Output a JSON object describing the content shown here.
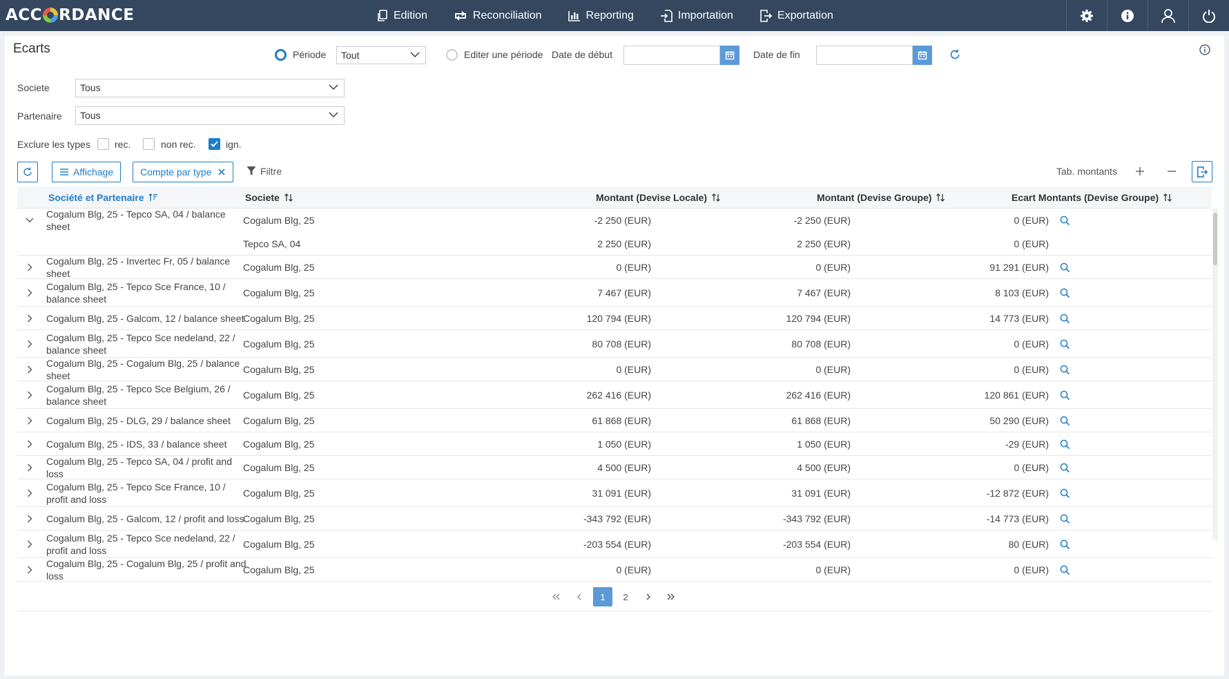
{
  "app": {
    "logo_left": "ACC",
    "logo_right": "RDANCE"
  },
  "nav": [
    {
      "label": "Edition",
      "icon": "copy-icon"
    },
    {
      "label": "Reconciliation",
      "icon": "swap-icon"
    },
    {
      "label": "Reporting",
      "icon": "bar-chart-icon"
    },
    {
      "label": "Importation",
      "icon": "import-icon"
    },
    {
      "label": "Exportation",
      "icon": "export-icon"
    }
  ],
  "page": {
    "title": "Ecarts"
  },
  "filters": {
    "periode_label": "Période",
    "periode_value": "Tout",
    "edit_periode_label": "Editer une période",
    "date_debut_label": "Date de début",
    "date_debut_value": "",
    "date_fin_label": "Date de fin",
    "date_fin_value": "",
    "societe_label": "Societe",
    "societe_value": "Tous",
    "partenaire_label": "Partenaire",
    "partenaire_value": "Tous",
    "exclude_label": "Exclure les types",
    "types": [
      {
        "label": "rec.",
        "checked": false
      },
      {
        "label": "non rec.",
        "checked": false
      },
      {
        "label": "ign.",
        "checked": true
      }
    ]
  },
  "toolbar": {
    "affichage_label": "Affichage",
    "compte_label": "Compte par type",
    "filtre_label": "Filtre",
    "tab_montants_label": "Tab. montants"
  },
  "table": {
    "columns": {
      "name": "Société et Partenaire",
      "societe": "Societe",
      "montant_locale": "Montant",
      "montant_locale_sub": "(Devise Locale)",
      "montant_groupe": "Montant",
      "montant_groupe_sub": "(Devise Groupe)",
      "ecart": "Ecart Montants",
      "ecart_sub": "(Devise Groupe)"
    },
    "rows": [
      {
        "name": "Cogalum Blg, 25 - Tepco SA, 04 / balance sheet",
        "societe": "Cogalum Blg, 25",
        "ml": "-2 250 (EUR)",
        "mg": "-2 250 (EUR)",
        "ec": "0 (EUR)"
      },
      {
        "name": "",
        "societe": "Tepco SA, 04",
        "ml": "2 250 (EUR)",
        "mg": "2 250 (EUR)",
        "ec": "0 (EUR)"
      },
      {
        "name": "Cogalum Blg, 25 - Invertec Fr, 05 / balance sheet",
        "societe": "Cogalum Blg, 25",
        "ml": "0 (EUR)",
        "mg": "0 (EUR)",
        "ec": "91 291 (EUR)"
      },
      {
        "name": "Cogalum Blg, 25 - Tepco Sce France, 10 / balance sheet",
        "societe": "Cogalum Blg, 25",
        "ml": "7 467 (EUR)",
        "mg": "7 467 (EUR)",
        "ec": "8 103 (EUR)"
      },
      {
        "name": "Cogalum Blg, 25 - Galcom, 12 / balance sheet",
        "societe": "Cogalum Blg, 25",
        "ml": "120 794 (EUR)",
        "mg": "120 794 (EUR)",
        "ec": "14 773 (EUR)"
      },
      {
        "name": "Cogalum Blg, 25 - Tepco Sce nedeland, 22 / balance sheet",
        "societe": "Cogalum Blg, 25",
        "ml": "80 708 (EUR)",
        "mg": "80 708 (EUR)",
        "ec": "0 (EUR)"
      },
      {
        "name": "Cogalum Blg, 25 - Cogalum Blg, 25 / balance sheet",
        "societe": "Cogalum Blg, 25",
        "ml": "0 (EUR)",
        "mg": "0 (EUR)",
        "ec": "0 (EUR)"
      },
      {
        "name": "Cogalum Blg, 25 - Tepco Sce Belgium, 26 / balance sheet",
        "societe": "Cogalum Blg, 25",
        "ml": "262 416 (EUR)",
        "mg": "262 416 (EUR)",
        "ec": "120 861 (EUR)"
      },
      {
        "name": "Cogalum Blg, 25 - DLG, 29 / balance sheet",
        "societe": "Cogalum Blg, 25",
        "ml": "61 868 (EUR)",
        "mg": "61 868 (EUR)",
        "ec": "50 290 (EUR)"
      },
      {
        "name": "Cogalum Blg, 25 - IDS, 33 / balance sheet",
        "societe": "Cogalum Blg, 25",
        "ml": "1 050 (EUR)",
        "mg": "1 050 (EUR)",
        "ec": "-29 (EUR)"
      },
      {
        "name": "Cogalum Blg, 25 - Tepco SA, 04 / profit and loss",
        "societe": "Cogalum Blg, 25",
        "ml": "4 500 (EUR)",
        "mg": "4 500 (EUR)",
        "ec": "0 (EUR)"
      },
      {
        "name": "Cogalum Blg, 25 - Tepco Sce France, 10 / profit and loss",
        "societe": "Cogalum Blg, 25",
        "ml": "31 091 (EUR)",
        "mg": "31 091 (EUR)",
        "ec": "-12 872 (EUR)"
      },
      {
        "name": "Cogalum Blg, 25 - Galcom, 12 / profit and loss",
        "societe": "Cogalum Blg, 25",
        "ml": "-343 792 (EUR)",
        "mg": "-343 792 (EUR)",
        "ec": "-14 773 (EUR)"
      },
      {
        "name": "Cogalum Blg, 25 - Tepco Sce nedeland, 22 / profit and loss",
        "societe": "Cogalum Blg, 25",
        "ml": "-203 554 (EUR)",
        "mg": "-203 554 (EUR)",
        "ec": "80 (EUR)"
      },
      {
        "name": "Cogalum Blg, 25 - Cogalum Blg, 25 / profit and loss",
        "societe": "Cogalum Blg, 25",
        "ml": "0 (EUR)",
        "mg": "0 (EUR)",
        "ec": "0 (EUR)"
      }
    ]
  },
  "pagination": {
    "pages": [
      "1",
      "2"
    ],
    "current": "1"
  }
}
